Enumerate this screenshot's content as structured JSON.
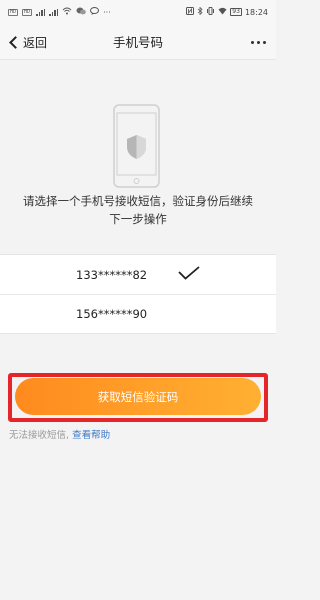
{
  "status_bar": {
    "hd1": "HD",
    "hd2": "HD",
    "battery": "93",
    "time": "18:24"
  },
  "nav": {
    "back_label": "返回",
    "title": "手机号码"
  },
  "prompt": "请选择一个手机号接收短信，验证身份后继续下一步操作",
  "phones": [
    {
      "number": "133******82",
      "selected": true
    },
    {
      "number": "156******90",
      "selected": false
    }
  ],
  "action_button": "获取短信验证码",
  "help": {
    "text": "无法接收短信,",
    "link": "查看帮助"
  },
  "colors": {
    "accent": "#ffa22a",
    "highlight_border": "#e5252a",
    "link": "#3d78c6"
  }
}
